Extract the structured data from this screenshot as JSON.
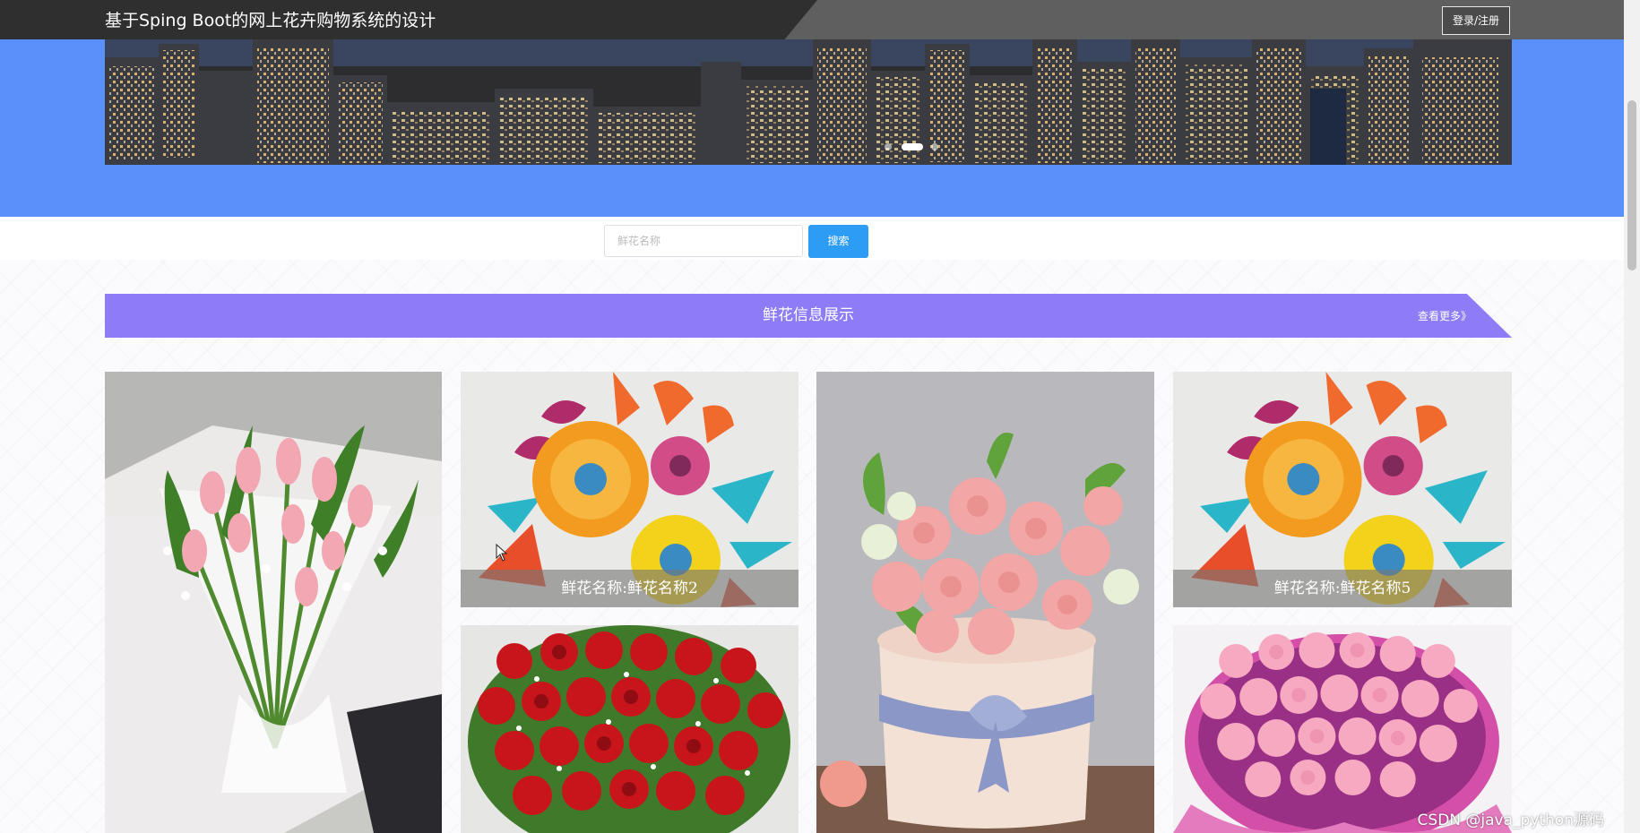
{
  "header": {
    "site_title": "基于Sping Boot的网上花卉购物系统的设计",
    "login_label": "登录/注册"
  },
  "banner": {
    "slide_count": 3,
    "active_slide": 2
  },
  "search": {
    "placeholder": "鲜花名称",
    "button_label": "搜索"
  },
  "section": {
    "title": "鲜花信息展示",
    "more_label": "查看更多》"
  },
  "products": [
    {
      "name": "",
      "image": "tulip-bouquet"
    },
    {
      "name": "鲜花名称:鲜花名称2",
      "image": "paper-flowers"
    },
    {
      "name": "",
      "image": "red-roses"
    },
    {
      "name": "",
      "image": "pink-rose-box"
    },
    {
      "name": "鲜花名称:鲜花名称5",
      "image": "paper-flowers"
    },
    {
      "name": "",
      "image": "pink-carnations"
    }
  ],
  "colors": {
    "banner_bg": "#5b8ff9",
    "section_bar": "#8e7cf7",
    "search_button": "#2d9cf5",
    "top_bar": "#2f2f2f"
  },
  "watermark": "CSDN @java_python源码"
}
